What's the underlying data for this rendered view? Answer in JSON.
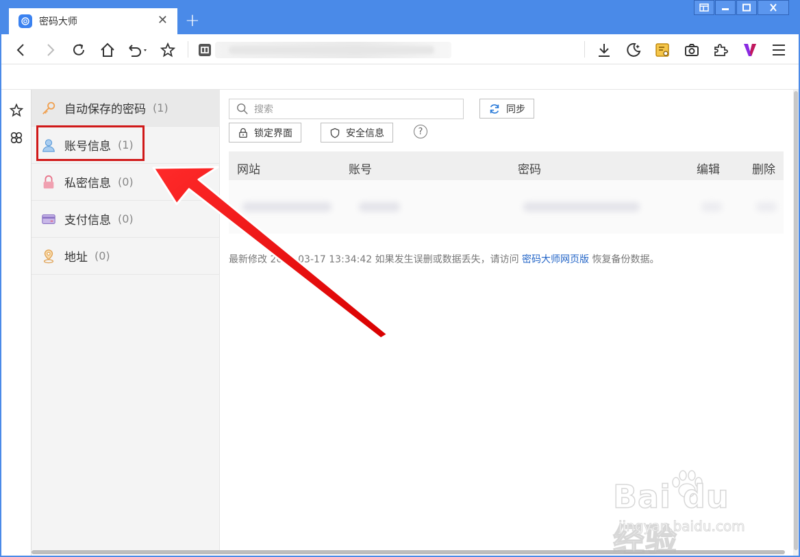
{
  "browser": {
    "tab_title": "密码大师",
    "new_tab_label": "+",
    "close_tab_label": "✕"
  },
  "sidebar": {
    "items": [
      {
        "label": "自动保存的密码",
        "count": "(1)"
      },
      {
        "label": "账号信息",
        "count": "(1)"
      },
      {
        "label": "私密信息",
        "count": "(0)"
      },
      {
        "label": "支付信息",
        "count": "(0)"
      },
      {
        "label": "地址",
        "count": "(0)"
      }
    ]
  },
  "main": {
    "search_placeholder": "搜索",
    "sync_label": "同步",
    "lock_label": "锁定界面",
    "security_label": "安全信息",
    "help_label": "?",
    "columns": [
      "网站",
      "账号",
      "密码",
      "编辑",
      "删除"
    ],
    "footer_prefix": "最新修改",
    "footer_date": "2023-03-17 13:34:42 如果发生误删或数据丢失，请访问",
    "footer_link": "密码大师网页版",
    "footer_suffix": "恢复备份数据。"
  },
  "watermark": {
    "main": "Bai du 经验",
    "sub": "jingyan.baidu.com"
  },
  "colors": {
    "chrome_blue": "#4a8ae8",
    "highlight_red": "#d01818",
    "link_blue": "#2365c7"
  }
}
